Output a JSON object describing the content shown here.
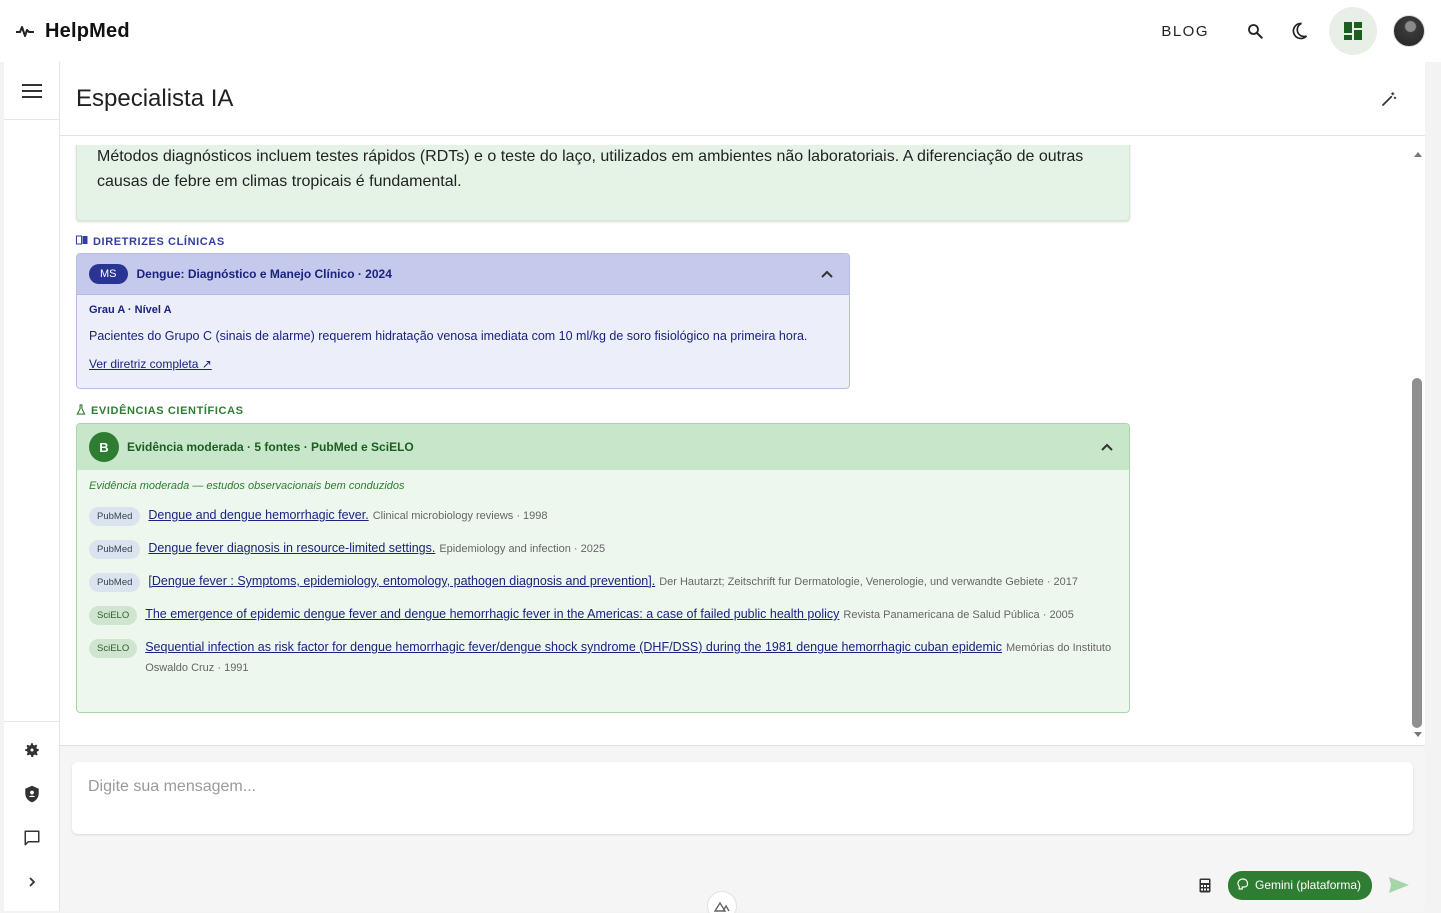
{
  "app": {
    "name": "HelpMed"
  },
  "topbar": {
    "blog_label": "BLOG"
  },
  "icons": {
    "brand": "pulse-icon",
    "search": "search-icon",
    "theme": "moon-icon",
    "dashboard": "dashboard-icon",
    "menu": "menu-icon",
    "settings": "gear-icon",
    "shield": "shield-icon",
    "chat": "chat-icon",
    "expand": "chevron-right-icon",
    "edit": "magic-pen-icon",
    "calculator": "calculator-icon",
    "send": "send-icon"
  },
  "page": {
    "title": "Especialista IA"
  },
  "summary": {
    "text": "Métodos diagnósticos incluem testes rápidos (RDTs) e o teste do laço, utilizados em ambientes não laboratoriais. A diferenciação de outras causas de febre em climas tropicais é fundamental."
  },
  "guidelines": {
    "section_label": "DIRETRIZES CLÍNICAS",
    "badge": "MS",
    "title": "Dengue: Diagnóstico e Manejo Clínico · 2024",
    "grade": "Grau A · Nível A",
    "text": "Pacientes do Grupo C (sinais de alarme) requerem hidratação venosa imediata com 10 ml/kg de soro fisiológico na primeira hora.",
    "link": "Ver diretriz completa ↗"
  },
  "evidence": {
    "section_label": "EVIDÊNCIAS CIENTÍFICAS",
    "grade_badge": "B",
    "title": "Evidência moderada · 5 fontes · PubMed e SciELO",
    "note": "Evidência moderada — estudos observacionais bem conduzidos",
    "refs": [
      {
        "source": "PubMed",
        "title": "Dengue and dengue hemorrhagic fever.",
        "meta": "Clinical microbiology reviews · 1998"
      },
      {
        "source": "PubMed",
        "title": "Dengue fever diagnosis in resource-limited settings.",
        "meta": "Epidemiology and infection · 2025"
      },
      {
        "source": "PubMed",
        "title": "[Dengue fever : Symptoms, epidemiology, entomology, pathogen diagnosis and prevention].",
        "meta": "Der Hautarzt; Zeitschrift fur Dermatologie, Venerologie, und verwandte Gebiete · 2017"
      },
      {
        "source": "SciELO",
        "title": "The emergence of epidemic dengue fever and dengue hemorrhagic fever in the Americas: a case of failed public health policy",
        "meta": "Revista Panamericana de Salud Pública · 2005"
      },
      {
        "source": "SciELO",
        "title": "Sequential infection as risk factor for dengue hemorrhagic fever/dengue shock syndrome (DHF/DSS) during the 1981 dengue hemorrhagic cuban epidemic",
        "meta": "Memórias do Instituto Oswaldo Cruz · 1991"
      }
    ]
  },
  "composer": {
    "placeholder": "Digite sua mensagem...",
    "value": "",
    "model_label": "Gemini (plataforma)"
  },
  "colors": {
    "accent_green": "#2e7d32",
    "guideline_blue": "#283593"
  }
}
